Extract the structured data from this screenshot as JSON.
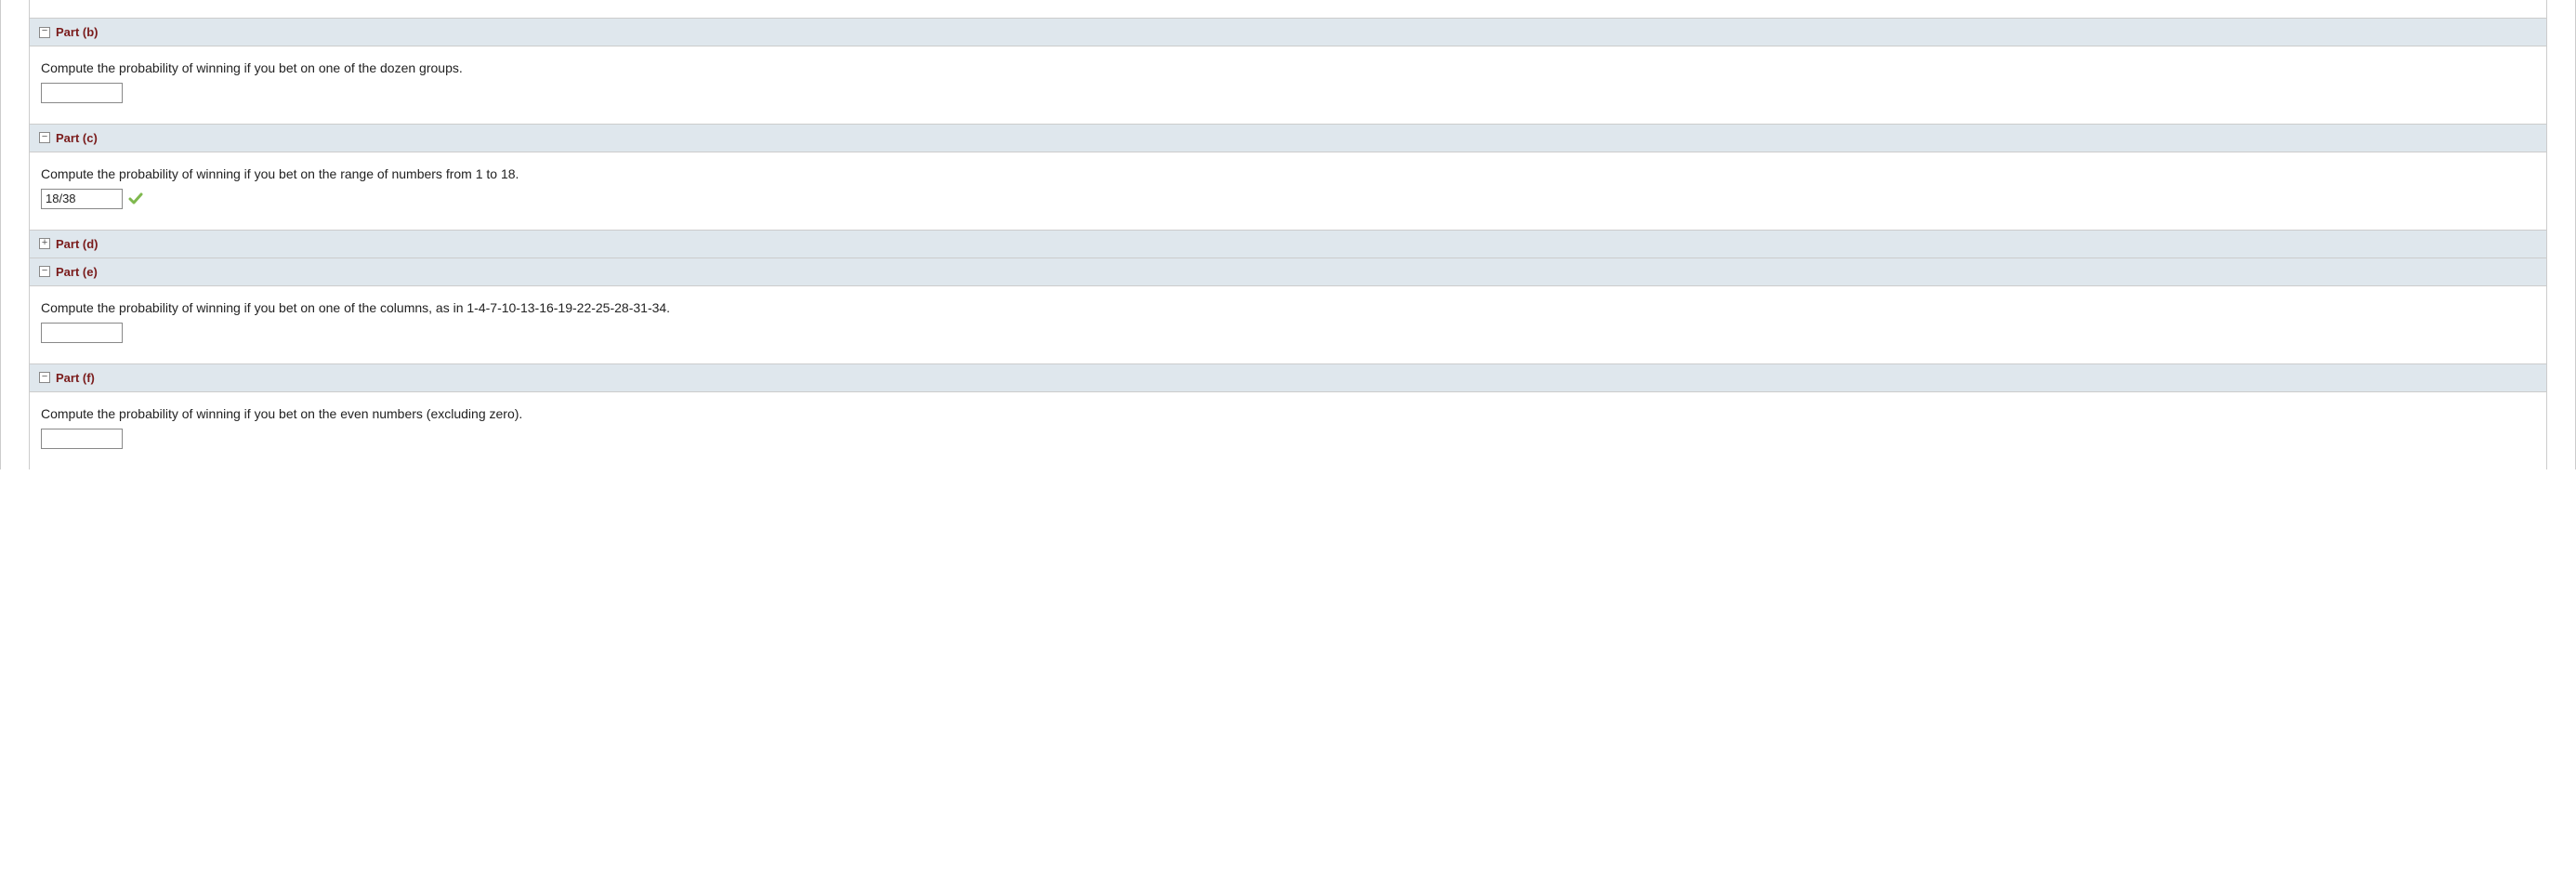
{
  "parts": {
    "b": {
      "label": "Part (b)",
      "expanded": true,
      "question": "Compute the probability of winning if you bet on one of the dozen groups.",
      "value": "",
      "correct": false
    },
    "c": {
      "label": "Part (c)",
      "expanded": true,
      "question": "Compute the probability of winning if you bet on the range of numbers from 1 to 18.",
      "value": "18/38",
      "correct": true
    },
    "d": {
      "label": "Part (d)",
      "expanded": false
    },
    "e": {
      "label": "Part (e)",
      "expanded": true,
      "question": "Compute the probability of winning if you bet on one of the columns, as in 1-4-7-10-13-16-19-22-25-28-31-34.",
      "value": "",
      "correct": false
    },
    "f": {
      "label": "Part (f)",
      "expanded": true,
      "question": "Compute the probability of winning if you bet on the even numbers (excluding zero).",
      "value": "",
      "correct": false
    }
  },
  "icons": {
    "minus": "−",
    "plus": "+"
  }
}
